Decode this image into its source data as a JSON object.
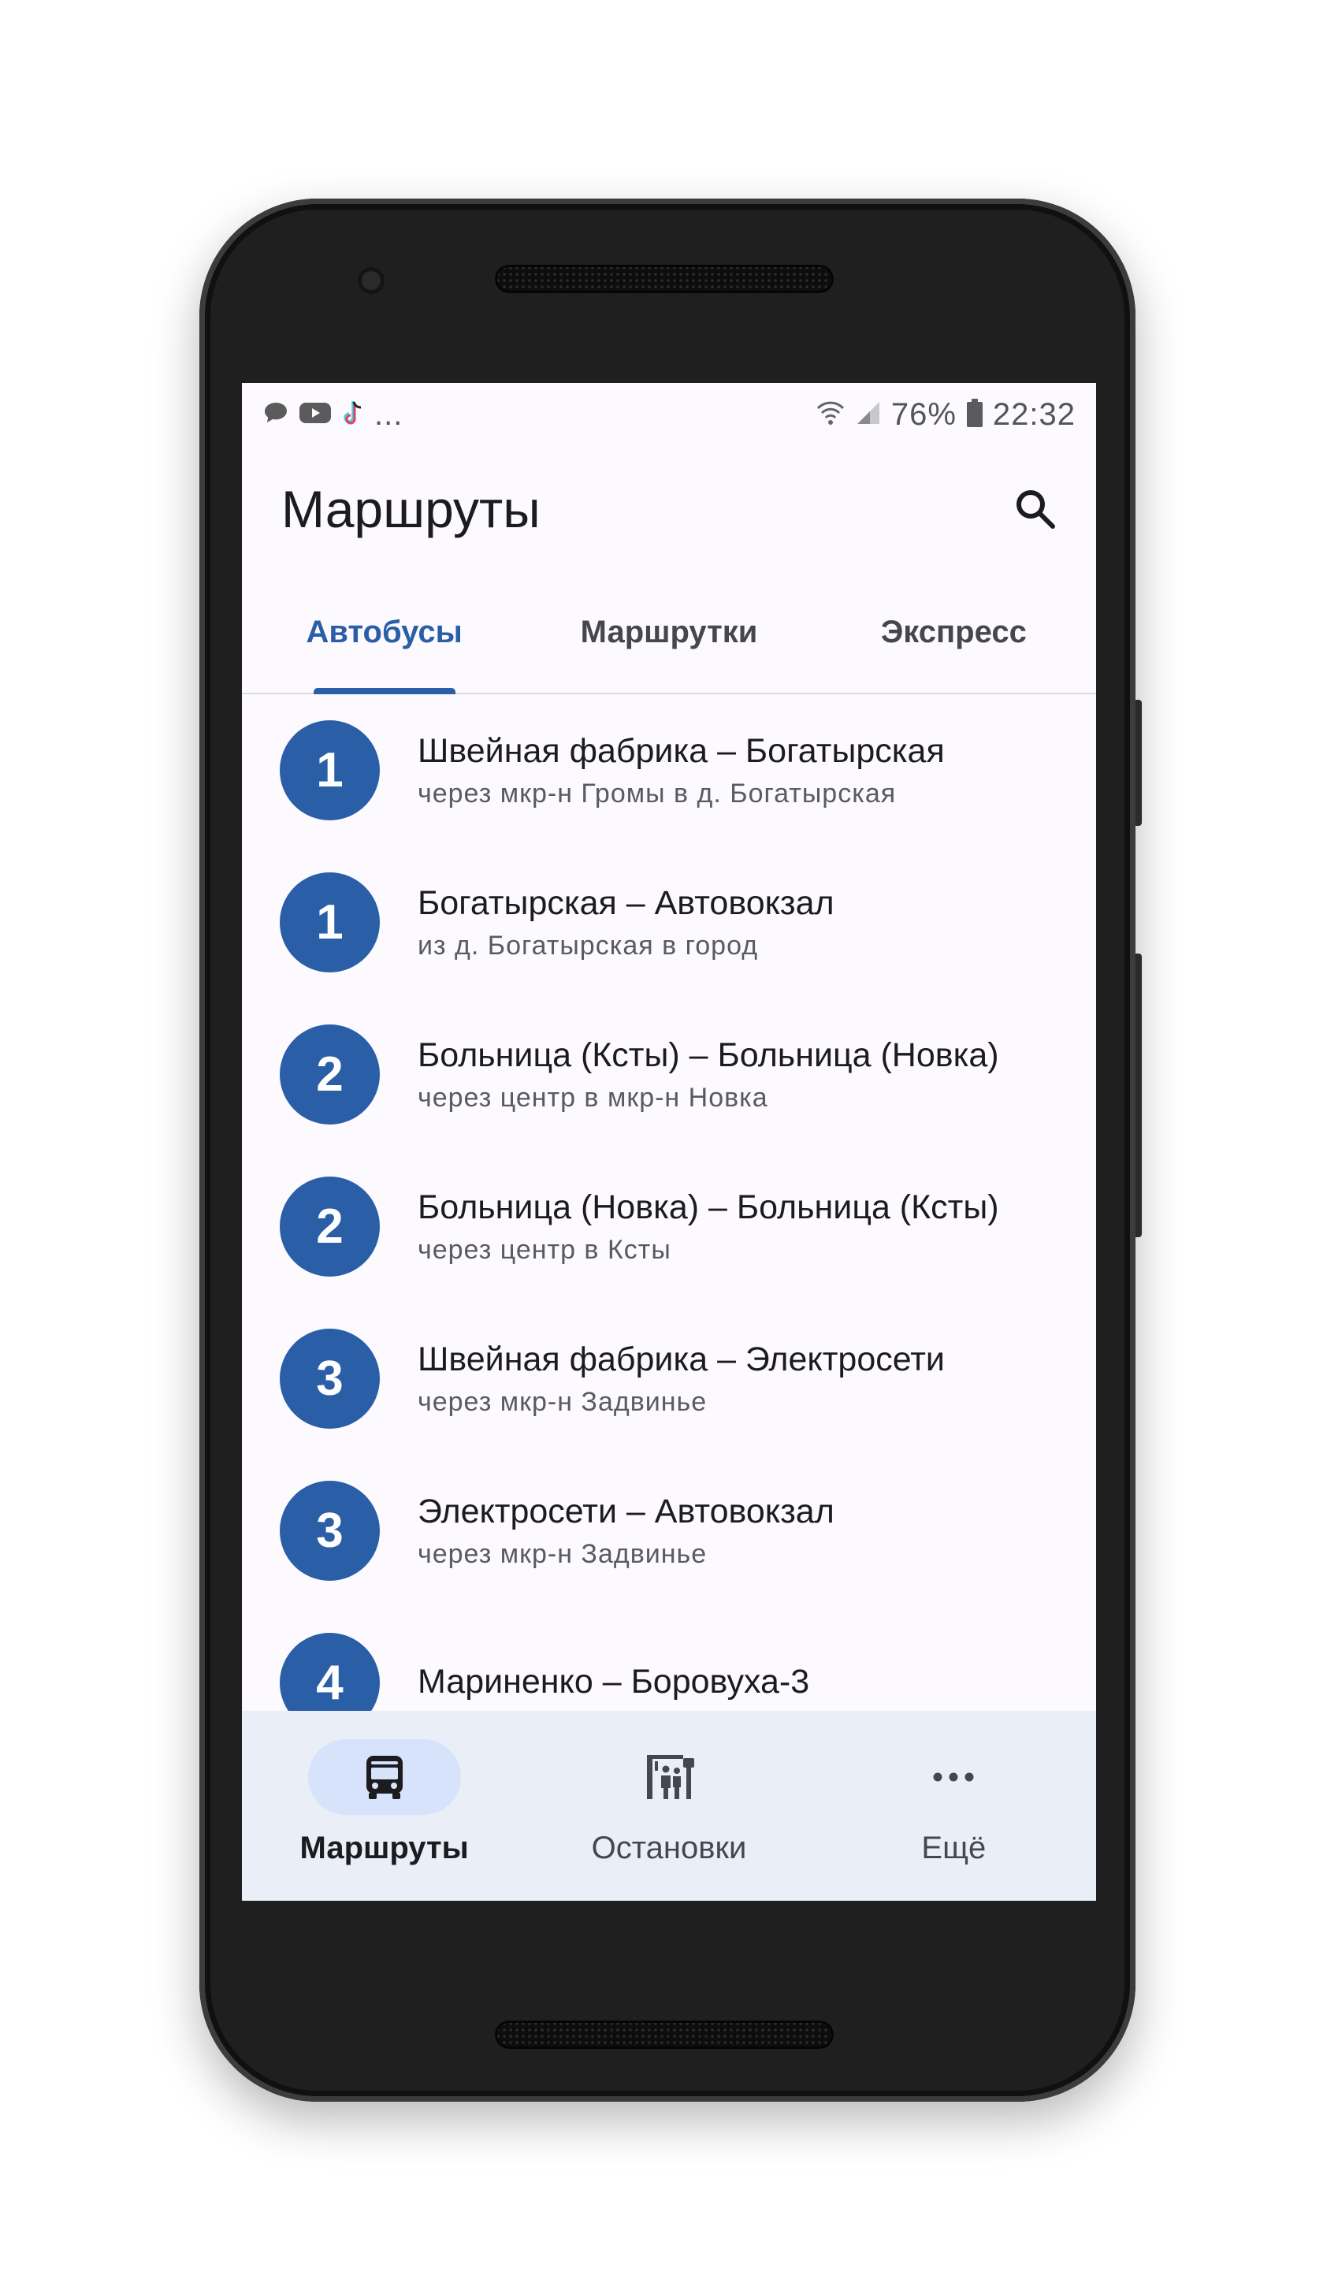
{
  "status_bar": {
    "notification_icons": [
      "chat-bubble-icon",
      "youtube-icon",
      "tiktok-icon"
    ],
    "overflow": "...",
    "battery": "76%",
    "time": "22:32"
  },
  "app_bar": {
    "title": "Маршруты",
    "search_icon": "search-icon"
  },
  "tabs": [
    {
      "label": "Автобусы",
      "active": true
    },
    {
      "label": "Маршрутки",
      "active": false
    },
    {
      "label": "Экспресс",
      "active": false
    }
  ],
  "routes": [
    {
      "number": "1",
      "title": "Швейная фабрика – Богатырская",
      "subtitle": "через мкр-н Громы в д. Богатырская"
    },
    {
      "number": "1",
      "title": "Богатырская – Автовокзал",
      "subtitle": "из д. Богатырская в город"
    },
    {
      "number": "2",
      "title": "Больница (Ксты) – Больница (Новка)",
      "subtitle": "через центр в мкр-н Новка"
    },
    {
      "number": "2",
      "title": "Больница (Новка) – Больница (Ксты)",
      "subtitle": "через центр в Ксты"
    },
    {
      "number": "3",
      "title": "Швейная фабрика – Электросети",
      "subtitle": "через мкр-н Задвинье"
    },
    {
      "number": "3",
      "title": "Электросети – Автовокзал",
      "subtitle": "через мкр-н Задвинье"
    },
    {
      "number": "4",
      "title": "Мариненко – Боровуха-3",
      "subtitle": ""
    }
  ],
  "bottom_nav": [
    {
      "label": "Маршруты",
      "icon": "bus-icon",
      "active": true
    },
    {
      "label": "Остановки",
      "icon": "bus-stop-icon",
      "active": false
    },
    {
      "label": "Ещё",
      "icon": "more-horizontal-icon",
      "active": false
    }
  ],
  "colors": {
    "accent": "#2a5ea7",
    "screen_background": "#fcfaff",
    "bottom_nav_background": "#e9eef7",
    "active_pill": "#d6e3fb"
  }
}
